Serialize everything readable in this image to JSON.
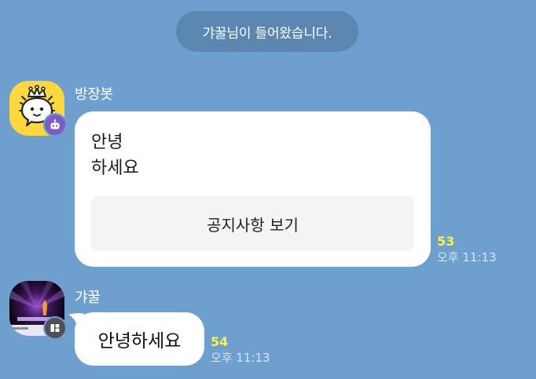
{
  "system_notice": "갸꿀님이 들어왔습니다.",
  "messages": [
    {
      "sender": "방장봇",
      "text_lines": [
        "안녕",
        "하세요"
      ],
      "button_label": "공지사항 보기",
      "unread_count": "53",
      "time": "오후 11:13",
      "avatar_icon": "crowned-speech-bubble-icon",
      "badge_icon": "robot-icon"
    },
    {
      "sender": "갸꿀",
      "text": "안녕하세요",
      "unread_count": "54",
      "time": "오후 11:13",
      "avatar_icon": "profile-photo",
      "badge_icon": "open-profile-icon"
    }
  ],
  "colors": {
    "background": "#6d9fcf",
    "bubble": "#ffffff",
    "unread": "#fff23a",
    "bot_avatar": "#ffd83b",
    "bot_badge": "#7d5cc7"
  }
}
